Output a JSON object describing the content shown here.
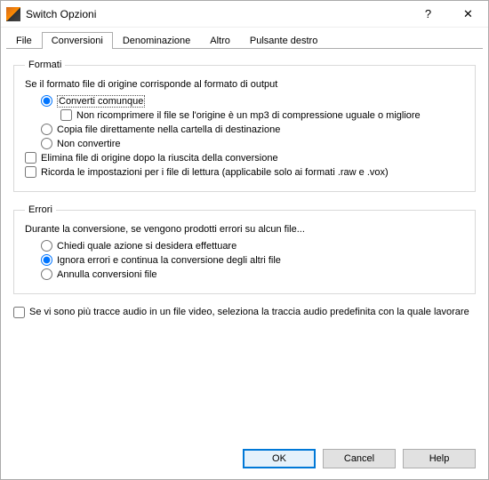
{
  "window": {
    "title": "Switch Opzioni"
  },
  "titlebar": {
    "help_glyph": "?",
    "close_glyph": "✕"
  },
  "tabs": {
    "file": "File",
    "conversioni": "Conversioni",
    "denominazione": "Denominazione",
    "altro": "Altro",
    "pulsante_destro": "Pulsante destro"
  },
  "formati": {
    "legend": "Formati",
    "intro": "Se il formato file di origine corrisponde al formato di output",
    "opt_converti": "Converti comunque",
    "chk_non_ricomprimere": "Non ricomprimere il file se l'origine è un mp3 di compressione uguale o migliore",
    "opt_copia": "Copia file direttamente nella cartella di destinazione",
    "opt_non_convertire": "Non convertire",
    "chk_elimina": "Elimina file di origine dopo la riuscita della conversione",
    "chk_ricorda": "Ricorda le impostazioni per i file di lettura (applicabile solo ai formati .raw e .vox)"
  },
  "errori": {
    "legend": "Errori",
    "intro": "Durante la conversione, se vengono prodotti errori su alcun file...",
    "opt_chiedi": "Chiedi quale azione si desidera effettuare",
    "opt_ignora": "Ignora errori e continua la conversione degli altri file",
    "opt_annulla": "Annulla conversioni file"
  },
  "extra": {
    "chk_multi_tracce": "Se vi sono più tracce audio in un file video, seleziona la traccia audio predefinita con la quale lavorare"
  },
  "buttons": {
    "ok": "OK",
    "cancel": "Cancel",
    "help": "Help"
  }
}
